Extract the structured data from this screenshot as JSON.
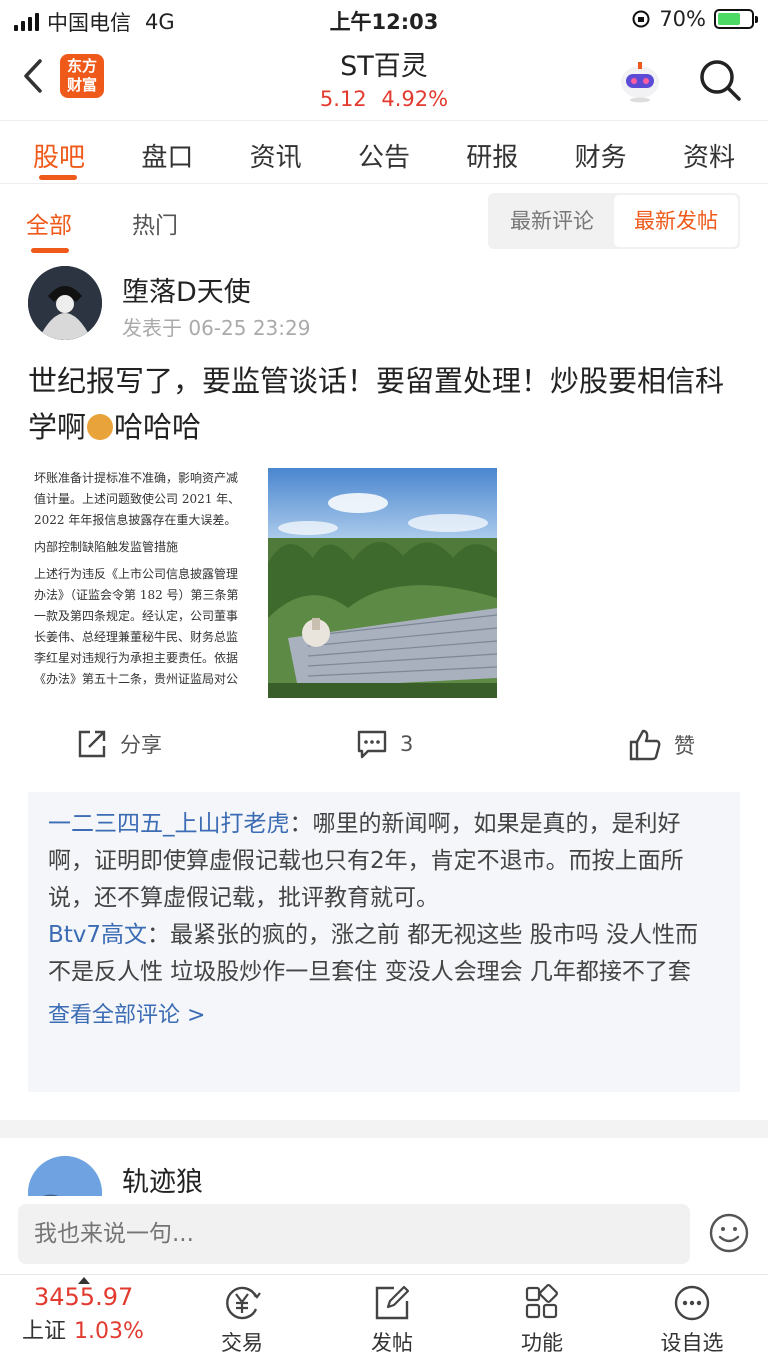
{
  "status_bar": {
    "carrier": "中国电信",
    "network": "4G",
    "time": "上午12:03",
    "battery": "70%",
    "battery_level": 0.7
  },
  "header": {
    "stock_name": "ST百灵",
    "price": "5.12",
    "change_pct": "4.92%",
    "logo_line1": "东方",
    "logo_line2": "财富"
  },
  "tabs": [
    "股吧",
    "盘口",
    "资讯",
    "公告",
    "研报",
    "财务",
    "资料"
  ],
  "filters": {
    "all": "全部",
    "hot": "热门",
    "sort_latest_comment": "最新评论",
    "sort_latest_post": "最新发帖"
  },
  "post": {
    "author": "堕落D天使",
    "time": "发表于 06-25 23:29",
    "text_1": "世纪报写了，要监管谈话！要留置处理！炒股要相信科学啊",
    "text_2": "哈哈哈",
    "doc_lines": [
      "坏账准备计提标准不准确，影响资产减值计量。上述问题致使公司 2021 年、2022 年年报信息披露存在重大误差。",
      "内部控制缺陷触发监管措施",
      "上述行为违反《上市公司信息披露管理办法》（证监会令第 182 号）第三条第一款及第四条规定。经认定，公司董事长姜伟、总经理兼董秘牛民、财务总监李红星对违规行为承担主要责任。依据《办法》第五十二条，贵州证监局对公"
    ],
    "share_label": "分享",
    "comment_count": "3",
    "like_label": "赞"
  },
  "comments": [
    {
      "user": "一二三四五_上山打老虎",
      "text": "：哪里的新闻啊，如果是真的，是利好啊，证明即使算虚假记载也只有2年，肯定不退市。而按上面所说，还不算虚假记载，批评教育就可。"
    },
    {
      "user": "Btv7高文",
      "text": "：最紧张的疯的，涨之前 都无视这些 股市吗 没人性而不是反人性 垃圾股炒作一旦套住 变没人会理会 几年都接不了套"
    }
  ],
  "view_all_comments": "查看全部评论 >",
  "next_post": {
    "author": "轨迹狼"
  },
  "comment_input": {
    "placeholder": "我也来说一句..."
  },
  "bottom_bar": {
    "index_value": "3455.97",
    "index_name": "上证",
    "index_pct": "1.03%",
    "trade": "交易",
    "post": "发帖",
    "functions": "功能",
    "watchlist": "设自选"
  }
}
